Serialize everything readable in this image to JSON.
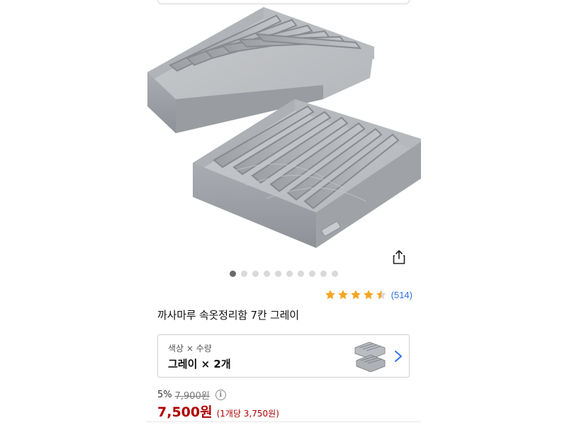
{
  "product": {
    "title": "까사마루 속옷정리함 7칸 그레이",
    "image_alt": "gray 7-compartment underwear organizer boxes (set of two)",
    "carousel": {
      "count": 10,
      "active": 0
    },
    "rating": {
      "stars": 4.5,
      "count_label": "(514)"
    }
  },
  "option": {
    "label": "색상 × 수량",
    "value": "그레이 × 2개"
  },
  "pricing": {
    "discount": "5%",
    "original": "7,900원",
    "price": "7,500원",
    "unit_price": "(1개당 3,750원)"
  },
  "icons": {
    "share": "share-icon",
    "info": "info-icon",
    "chevron": "chevron-right-icon",
    "star": "star-icon"
  },
  "colors": {
    "price": "#ae0000",
    "rating_count": "#2f6fe4",
    "star": "#f5a623",
    "chevron": "#2f6fe4"
  }
}
